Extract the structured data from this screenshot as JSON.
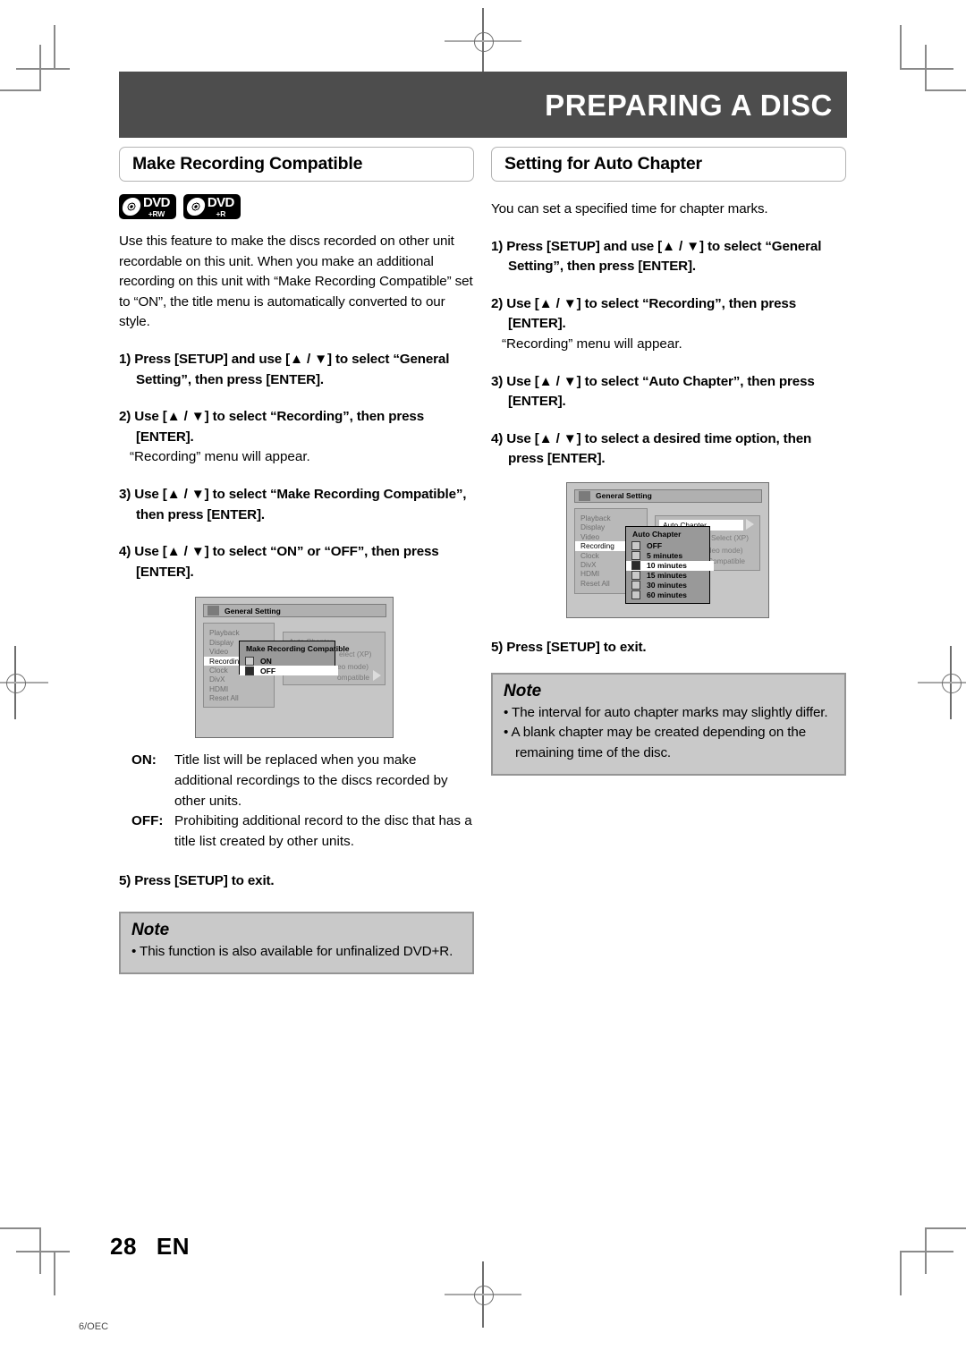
{
  "banner": {
    "title": "PREPARING A DISC"
  },
  "page": {
    "number": "28",
    "lang": "EN",
    "code": "6/OEC"
  },
  "left": {
    "section_title": "Make Recording Compatible",
    "badges": [
      {
        "name": "dvd-plus-rw-badge",
        "main": "DVD",
        "sub": "+RW"
      },
      {
        "name": "dvd-plus-r-badge",
        "main": "DVD",
        "sub": "+R"
      }
    ],
    "intro": "Use this feature to make the discs recorded on other unit recordable on this unit. When you make an additional recording on this unit with “Make Recording Compatible” set to “ON”, the title menu is automatically converted to our style.",
    "steps": [
      {
        "text": "1) Press [SETUP] and use [▲ / ▼] to select “General Setting”, then press [ENTER]."
      },
      {
        "text": "2) Use [▲ / ▼] to select “Recording”, then press [ENTER].",
        "sub": "“Recording” menu will appear."
      },
      {
        "text": "3) Use [▲ / ▼] to select “Make Recording Compatible”, then press [ENTER]."
      },
      {
        "text": "4) Use [▲ / ▼] to select “ON” or “OFF”, then press [ENTER]."
      }
    ],
    "definitions": [
      {
        "key": "ON:",
        "value": "Title list will be replaced when you make additional recordings to the discs recorded by other units."
      },
      {
        "key": "OFF:",
        "value": "Prohibiting additional record to the disc that has a title list created by other units."
      }
    ],
    "final_step": "5) Press [SETUP] to exit.",
    "note": {
      "header": "Note",
      "items": [
        "This function is also available for unfinalized DVD+R."
      ]
    },
    "osd": {
      "window_title": "General Setting",
      "nav_items": [
        "Playback",
        "Display",
        "Video",
        "Recording",
        "Clock",
        "DivX",
        "HDMI",
        "Reset All"
      ],
      "nav_selected": "Recording",
      "panel_rows": [
        "Auto Chapter",
        "elect (XP)",
        "eo mode)",
        "ompatible"
      ],
      "popup": {
        "title": "Make Recording Compatible",
        "options": [
          {
            "label": "ON",
            "checked": false,
            "selected": false
          },
          {
            "label": "OFF",
            "checked": true,
            "selected": true
          }
        ]
      }
    }
  },
  "right": {
    "section_title": "Setting for Auto Chapter",
    "intro": "You can set a specified time for chapter marks.",
    "steps": [
      {
        "text": "1) Press [SETUP] and use [▲ / ▼] to select “General Setting”, then press [ENTER]."
      },
      {
        "text": "2) Use [▲ / ▼] to select “Recording”, then press [ENTER].",
        "sub": "“Recording” menu will appear."
      },
      {
        "text": "3) Use [▲ / ▼] to select “Auto Chapter”, then press [ENTER]."
      },
      {
        "text": "4) Use [▲ / ▼] to select a desired time option, then press [ENTER]."
      }
    ],
    "final_step": "5) Press [SETUP] to exit.",
    "note": {
      "header": "Note",
      "items": [
        "The interval for auto chapter marks may slightly differ.",
        "A blank chapter may be created depending on the remaining time of the disc."
      ]
    },
    "osd": {
      "window_title": "General Setting",
      "nav_items": [
        "Playback",
        "Display",
        "Video",
        "Recording",
        "Clock",
        "DivX",
        "HDMI",
        "Reset All"
      ],
      "nav_selected": "Recording",
      "highlight_row": "Auto Chapter",
      "panel_rows": [
        "Select (XP)",
        "ideo mode)",
        "Compatible"
      ],
      "popup": {
        "title": "Auto Chapter",
        "options": [
          {
            "label": "OFF",
            "checked": false,
            "selected": false
          },
          {
            "label": "  5 minutes",
            "checked": false,
            "selected": false
          },
          {
            "label": "10 minutes",
            "checked": true,
            "selected": true
          },
          {
            "label": "15 minutes",
            "checked": false,
            "selected": false
          },
          {
            "label": "30 minutes",
            "checked": false,
            "selected": false
          },
          {
            "label": "60 minutes",
            "checked": false,
            "selected": false
          }
        ]
      }
    }
  },
  "colors": {
    "banner_bg": "#4d4d4d",
    "note_bg": "#c9c9c9",
    "note_border": "#949494",
    "osd_bg": "#c6c6c6"
  }
}
